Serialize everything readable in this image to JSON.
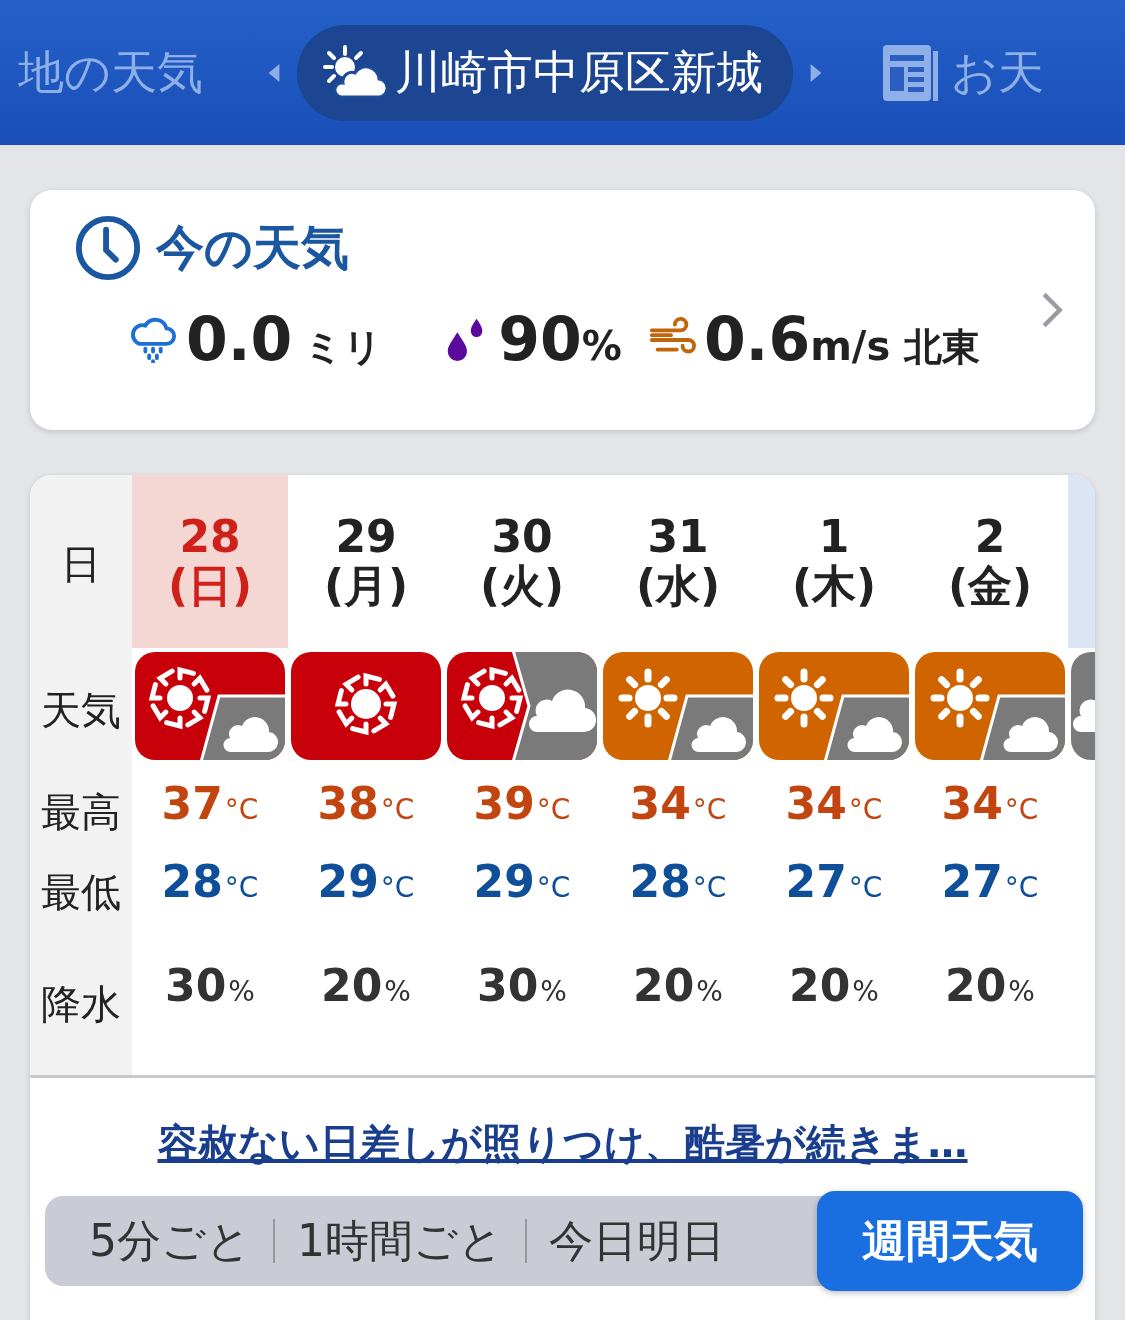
{
  "top_nav": {
    "prev_label": "地の天気",
    "location": "川崎市中原区新城",
    "next_label": "お天"
  },
  "current": {
    "title": "今の天気",
    "rain": {
      "value": "0.0",
      "unit": "ミリ"
    },
    "humidity": {
      "value": "90",
      "unit": "%"
    },
    "wind": {
      "value": "0.6",
      "unit": "m/s",
      "direction": "北東"
    }
  },
  "forecast": {
    "row_labels": [
      "日",
      "天気",
      "最高",
      "最低",
      "降水"
    ],
    "days": [
      {
        "date": "28",
        "weekday": "(日)",
        "selected": true,
        "kind": "hot-cloudy",
        "high": {
          "value": "37",
          "unit": "°C"
        },
        "low": {
          "value": "28",
          "unit": "°C"
        },
        "precip": {
          "value": "30",
          "unit": "%"
        }
      },
      {
        "date": "29",
        "weekday": "(月)",
        "selected": false,
        "kind": "hot",
        "high": {
          "value": "38",
          "unit": "°C"
        },
        "low": {
          "value": "29",
          "unit": "°C"
        },
        "precip": {
          "value": "20",
          "unit": "%"
        }
      },
      {
        "date": "30",
        "weekday": "(火)",
        "selected": false,
        "kind": "hot-then-cloudy",
        "high": {
          "value": "39",
          "unit": "°C"
        },
        "low": {
          "value": "29",
          "unit": "°C"
        },
        "precip": {
          "value": "30",
          "unit": "%"
        }
      },
      {
        "date": "31",
        "weekday": "(水)",
        "selected": false,
        "kind": "sunny-cloudy",
        "high": {
          "value": "34",
          "unit": "°C"
        },
        "low": {
          "value": "28",
          "unit": "°C"
        },
        "precip": {
          "value": "20",
          "unit": "%"
        }
      },
      {
        "date": "1",
        "weekday": "(木)",
        "selected": false,
        "kind": "sunny-cloudy",
        "high": {
          "value": "34",
          "unit": "°C"
        },
        "low": {
          "value": "27",
          "unit": "°C"
        },
        "precip": {
          "value": "20",
          "unit": "%"
        }
      },
      {
        "date": "2",
        "weekday": "(金)",
        "selected": false,
        "kind": "sunny-cloudy",
        "high": {
          "value": "34",
          "unit": "°C"
        },
        "low": {
          "value": "27",
          "unit": "°C"
        },
        "precip": {
          "value": "20",
          "unit": "%"
        }
      },
      {
        "selected": false,
        "kind": "cloudy",
        "color": "#dbe5f3"
      }
    ],
    "summary_link": "容赦ない日差しが照りつけ、酷暑が続きま…",
    "views": [
      {
        "label": "5分ごと",
        "selected": false
      },
      {
        "label": "1時間ごと",
        "selected": false
      },
      {
        "label": "今日明日",
        "selected": false
      },
      {
        "label": "週間天気",
        "selected": true
      }
    ]
  }
}
